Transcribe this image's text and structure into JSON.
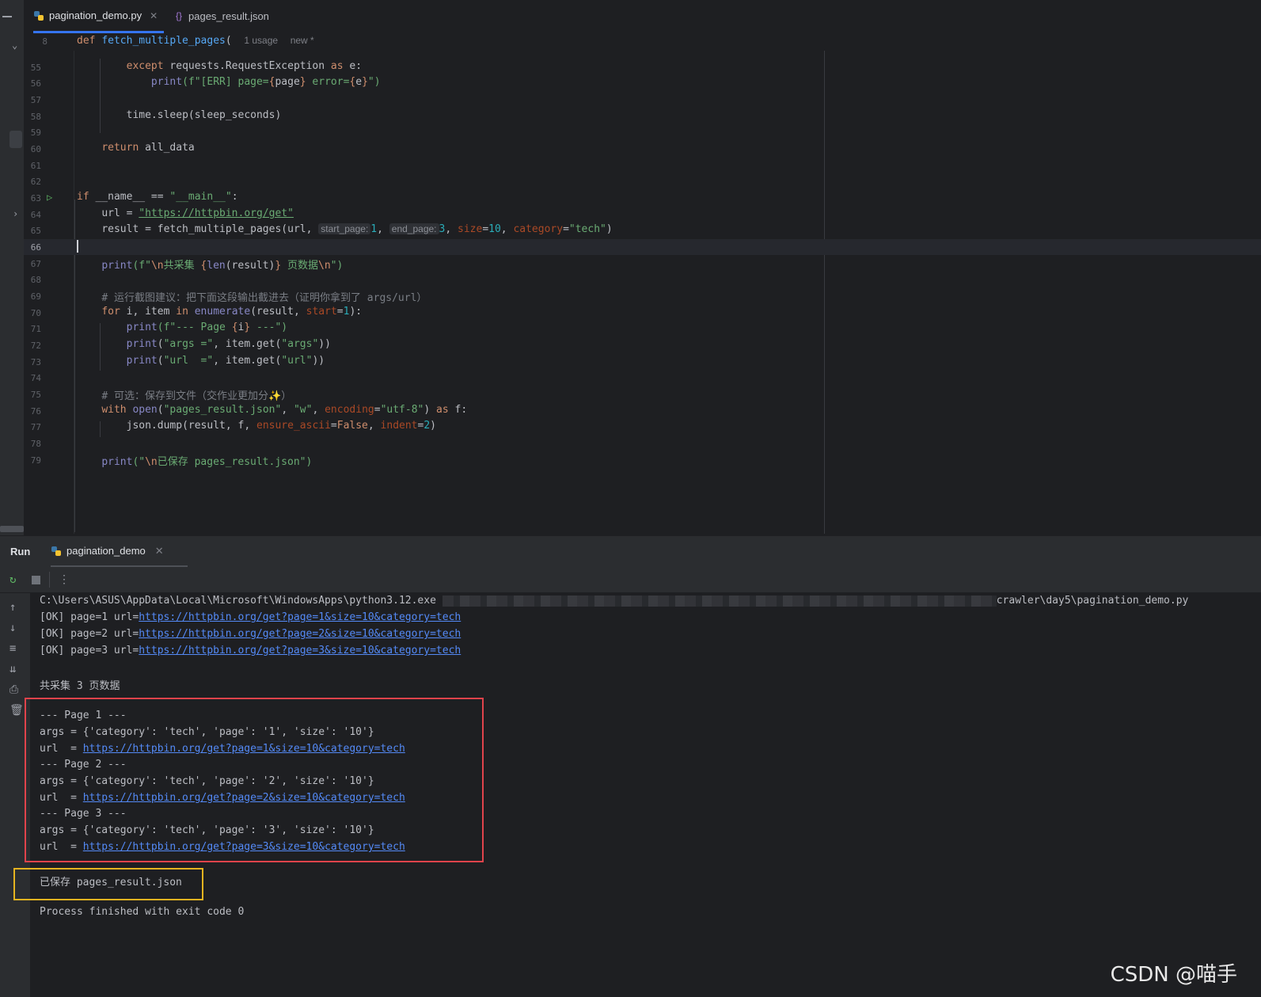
{
  "tabs": [
    {
      "label": "pagination_demo.py",
      "active": true
    },
    {
      "label": "pages_result.json",
      "active": false
    }
  ],
  "sticky": {
    "line": "8",
    "def": "def",
    "fn": "fetch_multiple_pages",
    "paren": "(",
    "usage": "1 usage",
    "new": "new *"
  },
  "editor": {
    "lines": [
      {
        "n": "55"
      },
      {
        "n": "56"
      },
      {
        "n": "57"
      },
      {
        "n": "58"
      },
      {
        "n": "59"
      },
      {
        "n": "60"
      },
      {
        "n": "61"
      },
      {
        "n": "62"
      },
      {
        "n": "63"
      },
      {
        "n": "64"
      },
      {
        "n": "65"
      },
      {
        "n": "66"
      },
      {
        "n": "67"
      },
      {
        "n": "68"
      },
      {
        "n": "69"
      },
      {
        "n": "70"
      },
      {
        "n": "71"
      },
      {
        "n": "72"
      },
      {
        "n": "73"
      },
      {
        "n": "74"
      },
      {
        "n": "75"
      },
      {
        "n": "76"
      },
      {
        "n": "77"
      },
      {
        "n": "78"
      },
      {
        "n": "79"
      }
    ],
    "t": {
      "except": "except",
      "reqexc": " requests.RequestException ",
      "as": "as",
      "e": " e:",
      "print": "print",
      "fpre": "(f\"[ERR] page=",
      "ob": "{",
      "page": "page",
      "cb": "}",
      "err": " error=",
      "e2": "e",
      "end1": "\")",
      "sleep": "time.sleep(sleep_seconds)",
      "ret": "return",
      "alldata": " all_data",
      "if": "if",
      "name": "__name__",
      "eq": " == ",
      "main": "\"__main__\"",
      "colon": ":",
      "url": "url = ",
      "urlval": "\"https://httpbin.org/get\"",
      "result": "result = fetch_multiple_pages(url, ",
      "hint_start": "start_page:",
      "one": "1",
      "comma": ", ",
      "hint_end": "end_page:",
      "three": "3",
      "size": "size",
      "eqs": "=",
      "ten": "10",
      "category": "category",
      "tech": "\"tech\"",
      "close": ")",
      "p67a": "(f\"",
      "nl": "\\n",
      "p67b": "共采集 ",
      "len": "len",
      "p67c": "(result)",
      "p67d": " 页数据",
      "p67e": "\")",
      "c69": "# 运行截图建议：把下面这段输出截进去（证明你拿到了 args/url）",
      "for": "for",
      "iitem": " i, item ",
      "in": "in",
      "enumerate": "enumerate",
      "resc": "(result, ",
      "start": "start",
      "one2": "1",
      "c70": "):",
      "p71a": "(f\"--- Page ",
      "i": "i",
      "p71b": " ---\")",
      "p72a": "(",
      "args_s": "\"args =\"",
      "p72b": ", item.get(",
      "args_k": "\"args\"",
      "p72c": "))",
      "url_s": "\"url  =\"",
      "url_k": "\"url\"",
      "c75": "# 可选：保存到文件（交作业更加分✨）",
      "with": "with",
      "open": "open",
      "p76a": "(",
      "fname": "\"pages_result.json\"",
      "w": "\"w\"",
      "encoding": "encoding",
      "utf8": "\"utf-8\"",
      "p76b": ") ",
      "f": " f:",
      "dump": "json.dump(result, f, ",
      "ensure": "ensure_ascii",
      "False": "False",
      "indent": "indent",
      "two": "2",
      "saved": "已保存 pages_result.json",
      "p79a": "(\"",
      "p79b": "\")"
    }
  },
  "run": {
    "title": "Run",
    "tab": "pagination_demo",
    "cmd_left": "C:\\Users\\ASUS\\AppData\\Local\\Microsoft\\WindowsApps\\python3.12.exe",
    "cmd_right": "crawler\\day5\\pagination_demo.py",
    "ok": [
      {
        "prefix": "[OK] page=1 url=",
        "link": "https://httpbin.org/get?page=1&size=10&category=tech"
      },
      {
        "prefix": "[OK] page=2 url=",
        "link": "https://httpbin.org/get?page=2&size=10&category=tech"
      },
      {
        "prefix": "[OK] page=3 url=",
        "link": "https://httpbin.org/get?page=3&size=10&category=tech"
      }
    ],
    "total": "共采集 3 页数据",
    "pages": [
      {
        "header": "--- Page 1 ---",
        "args": "args = {'category': 'tech', 'page': '1', 'size': '10'}",
        "url_prefix": "url  = ",
        "url": "https://httpbin.org/get?page=1&size=10&category=tech"
      },
      {
        "header": "--- Page 2 ---",
        "args": "args = {'category': 'tech', 'page': '2', 'size': '10'}",
        "url_prefix": "url  = ",
        "url": "https://httpbin.org/get?page=2&size=10&category=tech"
      },
      {
        "header": "--- Page 3 ---",
        "args": "args = {'category': 'tech', 'page': '3', 'size': '10'}",
        "url_prefix": "url  = ",
        "url": "https://httpbin.org/get?page=3&size=10&category=tech"
      }
    ],
    "saved": "已保存 pages_result.json",
    "exit": "Process finished with exit code 0"
  },
  "watermark": "CSDN @喵手",
  "colors": {
    "accent": "#3574f0",
    "red_box": "#e0434b",
    "yellow_box": "#e5b320",
    "link": "#548af7"
  }
}
